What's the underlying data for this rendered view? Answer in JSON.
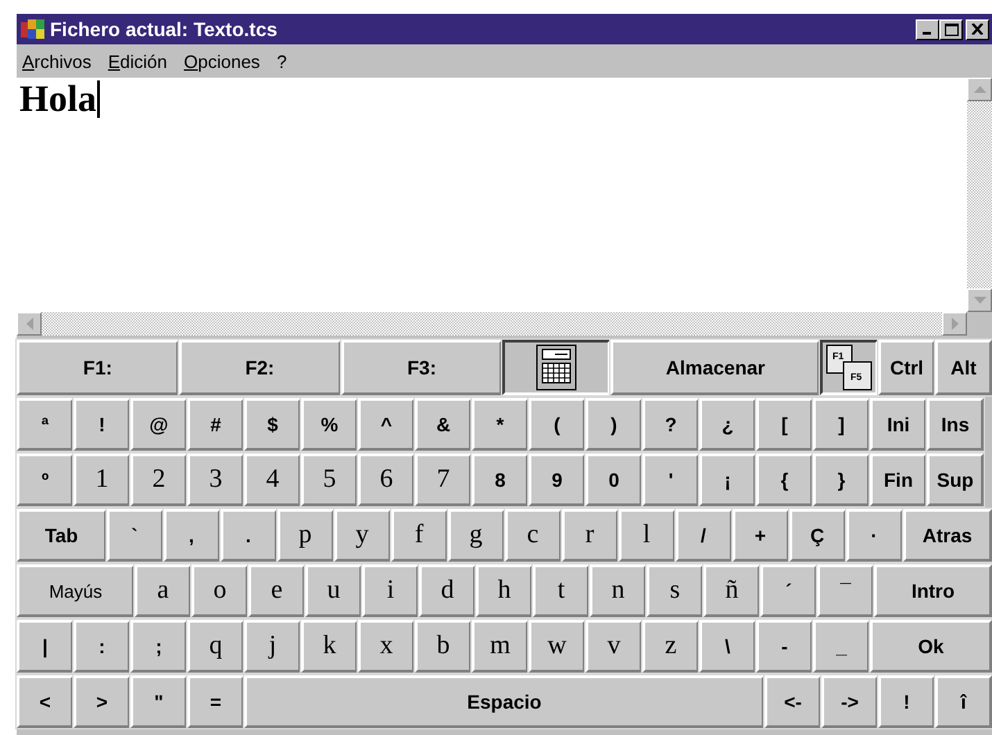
{
  "window": {
    "title": "Fichero actual: Texto.tcs"
  },
  "menu": [
    {
      "label": "Archivos",
      "underline_first": true
    },
    {
      "label": "Edición",
      "underline_first": true
    },
    {
      "label": "Opciones",
      "underline_first": true
    },
    {
      "label": "?",
      "underline_first": false
    }
  ],
  "document": {
    "text": "Hola"
  },
  "keyboard": {
    "function_keys": [
      {
        "kind": "fn",
        "label": "F1:",
        "pressed": false
      },
      {
        "kind": "fn",
        "label": "F2:",
        "pressed": false
      },
      {
        "kind": "fn",
        "label": "F3:",
        "pressed": false
      },
      {
        "kind": "calculator",
        "pressed": true
      },
      {
        "kind": "wide",
        "label": "Almacenar",
        "pressed": false
      },
      {
        "kind": "fkeys",
        "caps": [
          "F1",
          "F5"
        ],
        "pressed": true
      },
      {
        "kind": "sym",
        "label": "Ctrl",
        "pressed": false
      },
      {
        "kind": "sym",
        "label": "Alt",
        "pressed": false
      }
    ],
    "rows": [
      {
        "keys": [
          {
            "label": "ª",
            "kind": "sym"
          },
          {
            "label": "!",
            "kind": "sym"
          },
          {
            "label": "@",
            "kind": "sym"
          },
          {
            "label": "#",
            "kind": "sym"
          },
          {
            "label": "$",
            "kind": "sym"
          },
          {
            "label": "%",
            "kind": "sym"
          },
          {
            "label": "^",
            "kind": "sym"
          },
          {
            "label": "&",
            "kind": "sym"
          },
          {
            "label": "*",
            "kind": "sym"
          },
          {
            "label": "(",
            "kind": "sym"
          },
          {
            "label": ")",
            "kind": "sym"
          },
          {
            "label": "?",
            "kind": "sym"
          },
          {
            "label": "¿",
            "kind": "sym"
          },
          {
            "label": "[",
            "kind": "sym"
          },
          {
            "label": "]",
            "kind": "sym"
          },
          {
            "label": "Ini",
            "kind": "sym"
          },
          {
            "label": "Ins",
            "kind": "sym"
          }
        ]
      },
      {
        "keys": [
          {
            "label": "º",
            "kind": "sym"
          },
          {
            "label": "1",
            "kind": "letter"
          },
          {
            "label": "2",
            "kind": "letter"
          },
          {
            "label": "3",
            "kind": "letter"
          },
          {
            "label": "4",
            "kind": "letter"
          },
          {
            "label": "5",
            "kind": "letter"
          },
          {
            "label": "6",
            "kind": "letter"
          },
          {
            "label": "7",
            "kind": "letter"
          },
          {
            "label": "8",
            "kind": "sym"
          },
          {
            "label": "9",
            "kind": "sym"
          },
          {
            "label": "0",
            "kind": "sym"
          },
          {
            "label": "'",
            "kind": "sym"
          },
          {
            "label": "¡",
            "kind": "sym"
          },
          {
            "label": "{",
            "kind": "sym"
          },
          {
            "label": "}",
            "kind": "sym"
          },
          {
            "label": "Fin",
            "kind": "sym"
          },
          {
            "label": "Sup",
            "kind": "sym"
          }
        ]
      },
      {
        "keys": [
          {
            "label": "Tab",
            "kind": "wide"
          },
          {
            "label": "`",
            "kind": "sym"
          },
          {
            "label": ",",
            "kind": "sym"
          },
          {
            "label": ".",
            "kind": "sym"
          },
          {
            "label": "p",
            "kind": "letter"
          },
          {
            "label": "y",
            "kind": "letter"
          },
          {
            "label": "f",
            "kind": "letter"
          },
          {
            "label": "g",
            "kind": "letter"
          },
          {
            "label": "c",
            "kind": "letter"
          },
          {
            "label": "r",
            "kind": "letter"
          },
          {
            "label": "l",
            "kind": "letter"
          },
          {
            "label": "/",
            "kind": "sym"
          },
          {
            "label": "+",
            "kind": "sym"
          },
          {
            "label": "Ç",
            "kind": "sym"
          },
          {
            "label": "·",
            "kind": "sym"
          },
          {
            "label": "Atras",
            "kind": "wide"
          }
        ]
      },
      {
        "keys": [
          {
            "label": "Mayús",
            "kind": "plainwide"
          },
          {
            "label": "a",
            "kind": "letter"
          },
          {
            "label": "o",
            "kind": "letter"
          },
          {
            "label": "e",
            "kind": "letter"
          },
          {
            "label": "u",
            "kind": "letter"
          },
          {
            "label": "i",
            "kind": "letter"
          },
          {
            "label": "d",
            "kind": "letter"
          },
          {
            "label": "h",
            "kind": "letter"
          },
          {
            "label": "t",
            "kind": "letter"
          },
          {
            "label": "n",
            "kind": "letter"
          },
          {
            "label": "s",
            "kind": "letter"
          },
          {
            "label": "ñ",
            "kind": "letter"
          },
          {
            "label": "´",
            "kind": "sym"
          },
          {
            "label": "¯",
            "kind": "sym"
          },
          {
            "label": "Intro",
            "kind": "wide"
          }
        ]
      },
      {
        "keys": [
          {
            "label": "|",
            "kind": "sym"
          },
          {
            "label": ":",
            "kind": "sym"
          },
          {
            "label": ";",
            "kind": "sym"
          },
          {
            "label": "q",
            "kind": "letter"
          },
          {
            "label": "j",
            "kind": "letter"
          },
          {
            "label": "k",
            "kind": "letter"
          },
          {
            "label": "x",
            "kind": "letter"
          },
          {
            "label": "b",
            "kind": "letter"
          },
          {
            "label": "m",
            "kind": "letter"
          },
          {
            "label": "w",
            "kind": "letter"
          },
          {
            "label": "v",
            "kind": "letter"
          },
          {
            "label": "z",
            "kind": "letter"
          },
          {
            "label": "\\",
            "kind": "sym"
          },
          {
            "label": "-",
            "kind": "sym"
          },
          {
            "label": "_",
            "kind": "sym"
          },
          {
            "label": "Ok",
            "kind": "wide"
          }
        ]
      },
      {
        "keys": [
          {
            "label": "<",
            "kind": "sym"
          },
          {
            "label": ">",
            "kind": "sym"
          },
          {
            "label": "\"",
            "kind": "sym"
          },
          {
            "label": "=",
            "kind": "sym"
          },
          {
            "label": "Espacio",
            "kind": "space"
          },
          {
            "label": "<-",
            "kind": "sym"
          },
          {
            "label": "->",
            "kind": "sym"
          },
          {
            "label": "!",
            "kind": "sym"
          },
          {
            "label": "î",
            "kind": "sym"
          }
        ]
      }
    ]
  }
}
